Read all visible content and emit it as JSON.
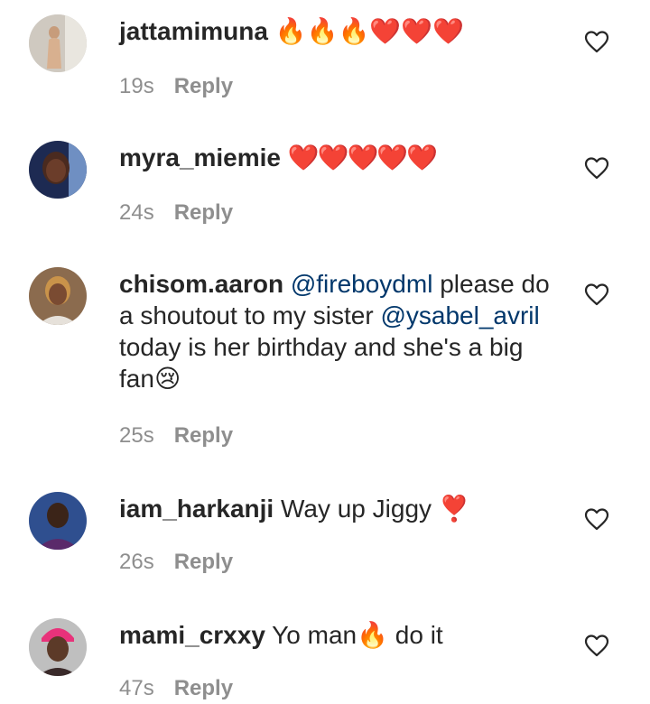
{
  "comments": [
    {
      "username": "jattamimuna",
      "text": "",
      "emoji": "🔥🔥🔥❤️❤️❤️",
      "time": "19s",
      "reply_label": "Reply",
      "avatar_icon": "avatar-photo"
    },
    {
      "username": "myra_miemie",
      "text": "",
      "emoji": "❤️❤️❤️❤️❤️",
      "time": "24s",
      "reply_label": "Reply",
      "avatar_icon": "avatar-photo"
    },
    {
      "username": "chisom.aaron",
      "mention1": "@fireboydml",
      "text1": " please do a shoutout to my sister ",
      "mention2": "@ysabel_avril",
      "text2": " today is her birthday and she's a big fan",
      "emoji": "😢",
      "time": "25s",
      "reply_label": "Reply",
      "avatar_icon": "avatar-photo"
    },
    {
      "username": "iam_harkanji",
      "text": " Way up Jiggy ",
      "emoji": "❣️",
      "time": "26s",
      "reply_label": "Reply",
      "avatar_icon": "avatar-photo"
    },
    {
      "username": "mami_crxxy",
      "text1": " Yo man",
      "emoji": "🔥",
      "text2": " do it",
      "time": "47s",
      "reply_label": "Reply",
      "avatar_icon": "avatar-photo"
    }
  ],
  "colors": {
    "text": "#262626",
    "mention": "#00376b",
    "meta": "#8e8e8e",
    "heart": "#e0182d"
  },
  "icons": {
    "like": "heart-outline-icon"
  }
}
